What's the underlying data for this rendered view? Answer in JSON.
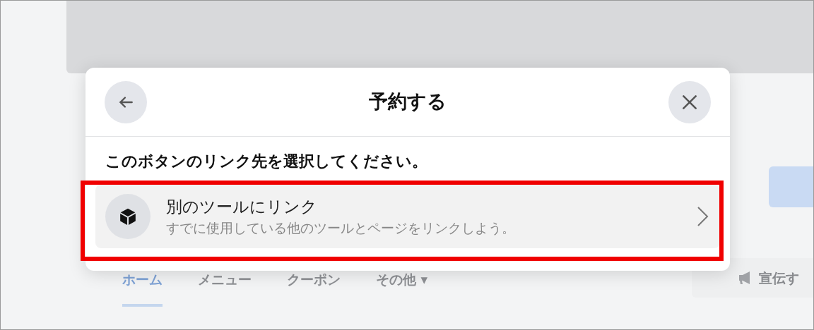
{
  "page": {
    "tabs": [
      {
        "label": "ホーム",
        "selected": true
      },
      {
        "label": "メニュー",
        "selected": false
      },
      {
        "label": "クーポン",
        "selected": false
      },
      {
        "label": "その他 ▾",
        "selected": false
      }
    ],
    "promote_button": "宣伝す"
  },
  "dialog": {
    "title": "予約する",
    "prompt": "このボタンのリンク先を選択してください。",
    "options": [
      {
        "title": "別のツールにリンク",
        "subtitle": "すでに使用している他のツールとページをリンクしよう。",
        "highlighted": true
      }
    ]
  }
}
